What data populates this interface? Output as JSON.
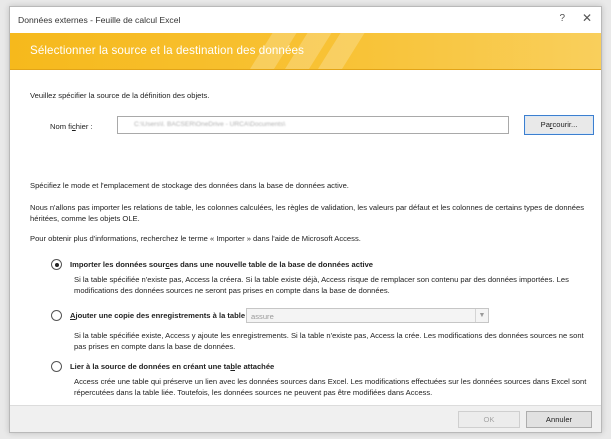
{
  "window": {
    "title": "Données externes - Feuille de calcul Excel",
    "help_glyph": "?",
    "close_glyph": "✕"
  },
  "banner": {
    "heading": "Sélectionner la source et la destination des données",
    "color": "#f6b91c"
  },
  "source": {
    "intro": "Veuillez spécifier la source de la définition des objets.",
    "file_label_pre": "Nom fi",
    "file_label_key": "c",
    "file_label_post": "hier :",
    "file_value": "C:\\Users\\I. BACSER\\OneDrive - URCA\\Documents\\",
    "browse_pre": "Pa",
    "browse_key": "r",
    "browse_post": "courir..."
  },
  "storage": {
    "mode_text": "Spécifiez le mode et l'emplacement de stockage des données dans la base de données active.",
    "note_text": "Nous n'allons pas importer les relations de table, les colonnes calculées, les règles de validation, les valeurs par défaut et les colonnes de certains types de données héritées, comme les objets OLE.",
    "help_text": "Pour obtenir plus d'informations, recherchez le terme « Importer » dans l'aide de Microsoft Access."
  },
  "options": [
    {
      "label_pre": "Importer les données sour",
      "label_key": "c",
      "label_post": "es dans une nouvelle table de la base de données active",
      "description": "Si la table spécifiée n'existe pas, Access la créera. Si la table existe déjà, Access risque de remplacer son contenu par des données importées. Les modifications des données sources ne seront pas prises en compte dans la base de données.",
      "selected": true
    },
    {
      "label_pre": "",
      "label_key": "A",
      "label_post": "jouter une copie des enregistrements à la table :",
      "select_value": "assure",
      "description": "Si la table spécifiée existe, Access y ajoute les enregistrements. Si la table n'existe pas, Access la crée. Les modifications des données sources ne sont pas prises en compte dans la base de données.",
      "selected": false
    },
    {
      "label_pre": "Lier à la source de données en créant une ta",
      "label_key": "b",
      "label_post": "le attachée",
      "description": "Access crée une table qui préserve un lien avec les données sources dans Excel. Les modifications effectuées sur les données sources dans Excel sont répercutées dans la table liée. Toutefois, les données sources ne peuvent pas être modifiées dans Access.",
      "selected": false
    }
  ],
  "footer": {
    "ok_label": "OK",
    "cancel_label": "Annuler"
  }
}
